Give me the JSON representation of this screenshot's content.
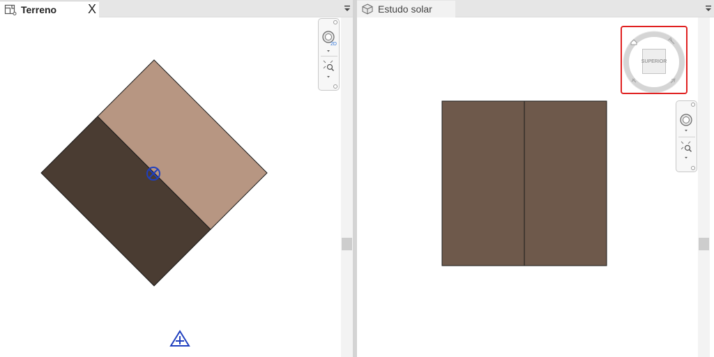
{
  "left_view": {
    "tab_label": "Terreno",
    "close_symbol": "X",
    "colors": {
      "light_region": "#b79682",
      "dark_region": "#4a3c32",
      "marker": "#1f3fbf",
      "outline": "#1a1a1a"
    }
  },
  "right_view": {
    "tab_label": "Estudo solar",
    "viewcube": {
      "face_label": "SUPERIOR",
      "highlight_color": "#e02020"
    },
    "colors": {
      "building": "#6e594b",
      "outline": "#1a1a1a"
    }
  },
  "navigation_bar": {
    "mode_2d_label": "2D"
  }
}
